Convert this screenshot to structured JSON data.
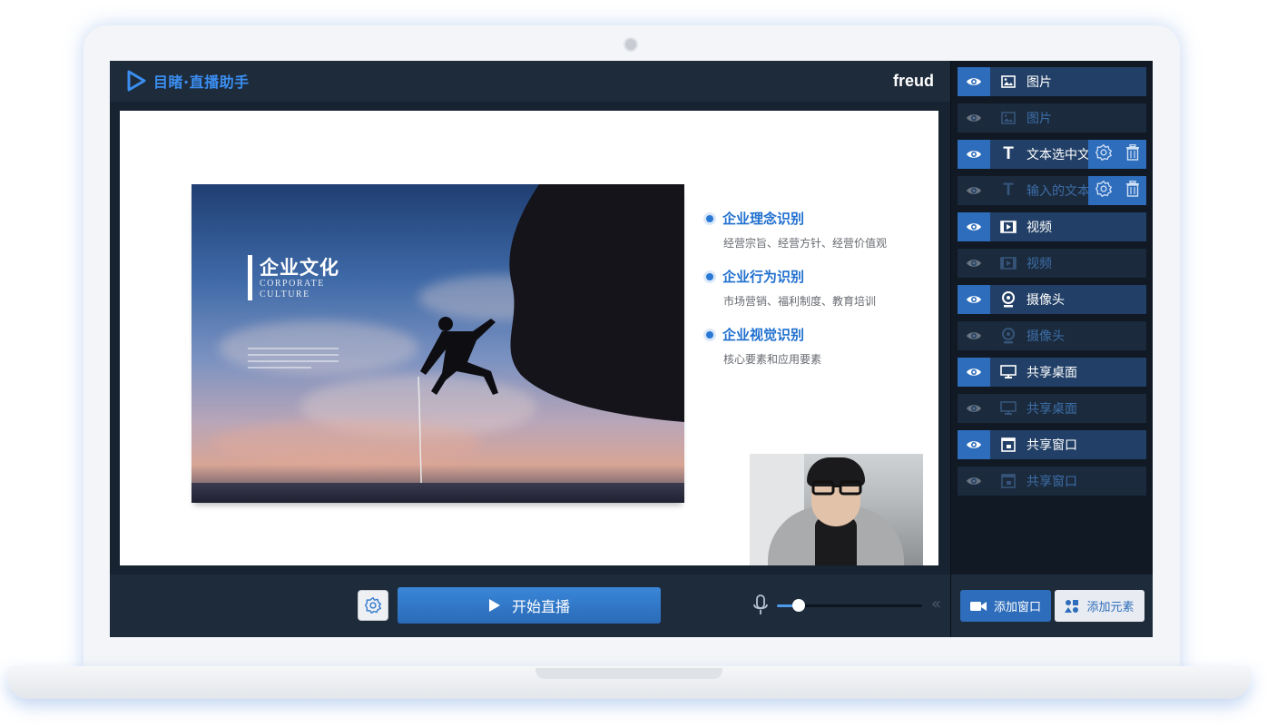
{
  "app": {
    "title": "目睹·直播助手",
    "username": "freud"
  },
  "slide": {
    "photo_title": "企业文化",
    "photo_subtitle_1": "CORPORATE",
    "photo_subtitle_2": "CULTURE",
    "bullets": [
      {
        "heading": "企业理念识别",
        "detail": "经营宗旨、经营方针、经营价值观"
      },
      {
        "heading": "企业行为识别",
        "detail": "市场营销、福利制度、教育培训"
      },
      {
        "heading": "企业视觉识别",
        "detail": "核心要素和应用要素"
      }
    ]
  },
  "controls": {
    "start_label": "开始直播",
    "volume_level": 0.15,
    "collapse_label": "«"
  },
  "layers": [
    {
      "label": "图片",
      "icon": "image-icon",
      "visible": true
    },
    {
      "label": "图片",
      "icon": "image-icon",
      "visible": false
    },
    {
      "label": "文本选中文",
      "icon": "text-icon",
      "visible": true,
      "tools": true
    },
    {
      "label": "输入的文本",
      "icon": "text-icon",
      "visible": false,
      "tools": true
    },
    {
      "label": "视频",
      "icon": "video-icon",
      "visible": true
    },
    {
      "label": "视频",
      "icon": "video-icon",
      "visible": false
    },
    {
      "label": "摄像头",
      "icon": "webcam-icon",
      "visible": true
    },
    {
      "label": "摄像头",
      "icon": "webcam-icon",
      "visible": false
    },
    {
      "label": "共享桌面",
      "icon": "monitor-icon",
      "visible": true
    },
    {
      "label": "共享桌面",
      "icon": "monitor-icon",
      "visible": false
    },
    {
      "label": "共享窗口",
      "icon": "window-icon",
      "visible": true
    },
    {
      "label": "共享窗口",
      "icon": "window-icon",
      "visible": false
    }
  ],
  "footer": {
    "add_window_label": "添加窗口",
    "add_element_label": "添加元素"
  },
  "colors": {
    "accent": "#2e6dbb",
    "panel_bg": "#101924",
    "topbar_bg": "#1d2b3b",
    "heading_blue": "#1f6fcf"
  }
}
